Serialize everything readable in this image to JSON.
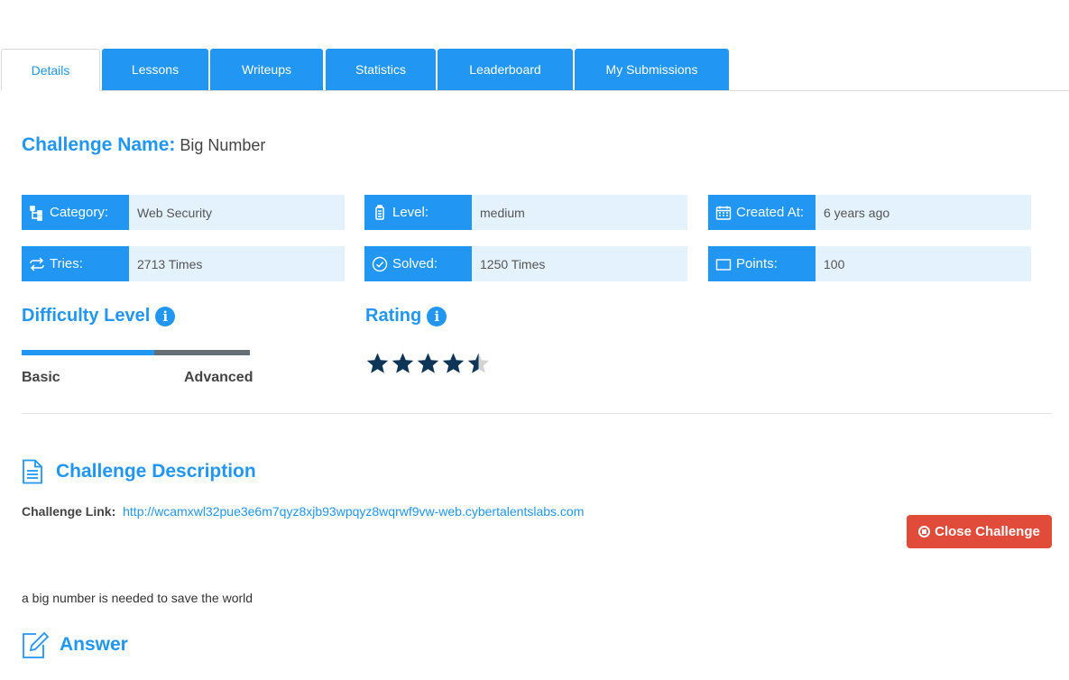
{
  "tabs": [
    {
      "label": "Details",
      "active": true
    },
    {
      "label": "Lessons"
    },
    {
      "label": "Writeups"
    },
    {
      "label": "Statistics"
    },
    {
      "label": "Leaderboard"
    },
    {
      "label": "My Submissions"
    }
  ],
  "challenge": {
    "name_label": "Challenge Name:",
    "name": "Big Number"
  },
  "info": {
    "category": {
      "label": "Category:",
      "value": "Web Security",
      "icon": "sitemap-icon"
    },
    "level": {
      "label": "Level:",
      "value": "medium",
      "icon": "battery-icon"
    },
    "created": {
      "label": "Created At:",
      "value": "6 years ago",
      "icon": "calendar-icon"
    },
    "tries": {
      "label": "Tries:",
      "value": "2713 Times",
      "icon": "exchange-icon"
    },
    "solved": {
      "label": "Solved:",
      "value": "1250 Times",
      "icon": "check-circle-icon"
    },
    "points": {
      "label": "Points:",
      "value": "100",
      "icon": "rectangle-icon"
    }
  },
  "difficulty": {
    "title": "Difficulty Level",
    "min_label": "Basic",
    "max_label": "Advanced",
    "level_fraction": 0.58
  },
  "rating": {
    "title": "Rating",
    "value": 4.5,
    "max": 5
  },
  "description": {
    "title": "Challenge Description",
    "link_label": "Challenge Link:",
    "link": "http://wcamxwl32pue3e6m7qyz8xjb93wpqyz8wqrwf9vw-web.cybertalentslabs.com",
    "text": "a big number is needed to save the world",
    "close_label": "Close Challenge"
  },
  "answer": {
    "title": "Answer"
  },
  "colors": {
    "primary": "#2196f3",
    "light_bg": "#e4f2fd",
    "danger": "#e04b3a",
    "star": "#0d3557"
  }
}
